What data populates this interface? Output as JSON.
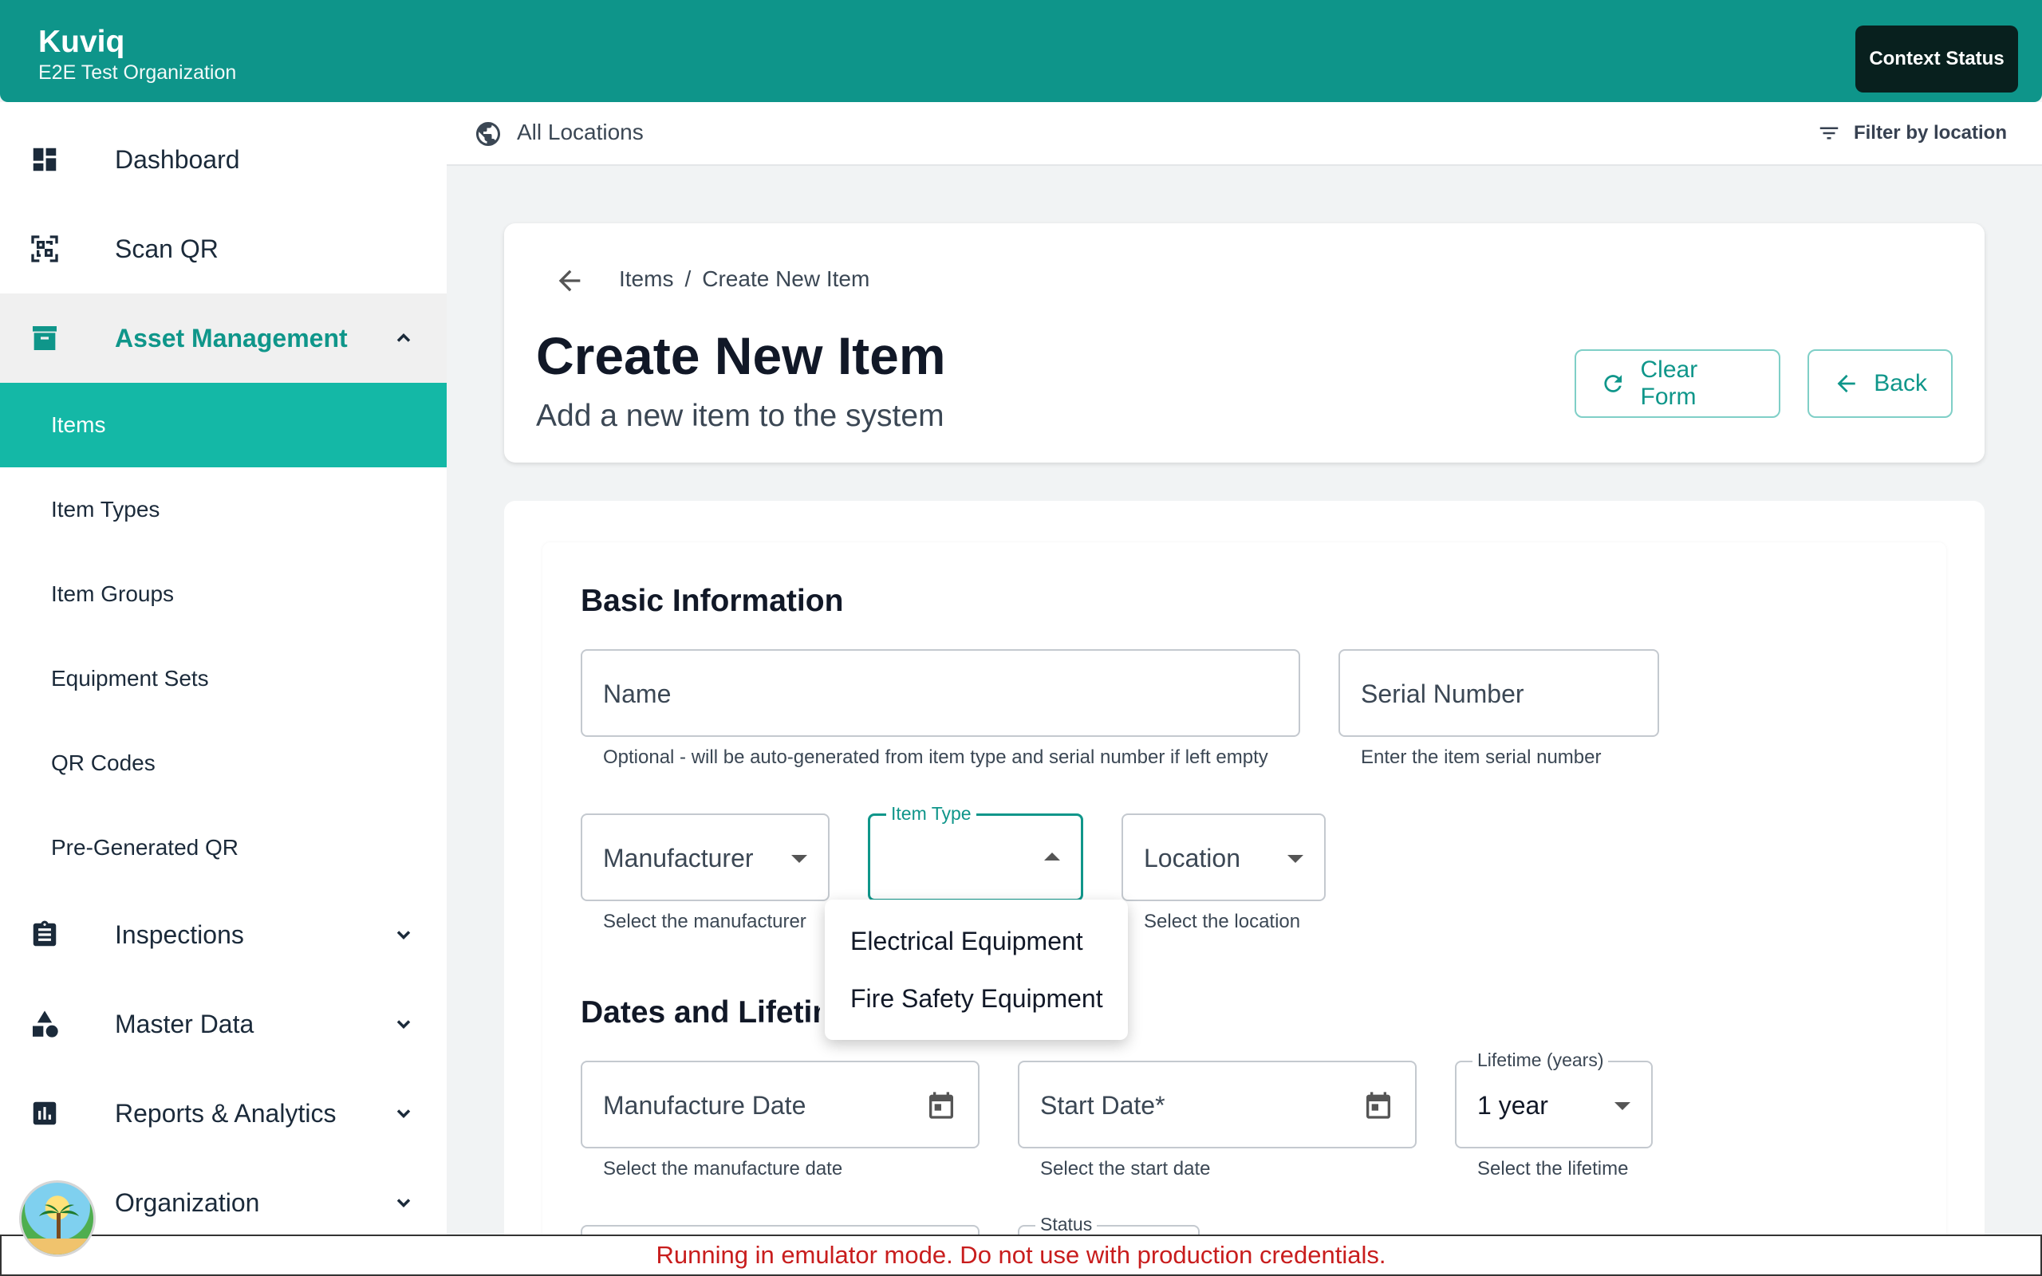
{
  "app": {
    "name": "Kuviq",
    "organization": "E2E Test Organization",
    "context_button": "Context Status"
  },
  "sidebar": {
    "items": [
      {
        "label": "Dashboard",
        "icon": "dashboard-icon"
      },
      {
        "label": "Scan QR",
        "icon": "qr-scan-icon"
      },
      {
        "label": "Asset Management",
        "icon": "archive-icon",
        "expanded": true
      },
      {
        "label": "Inspections",
        "icon": "clipboard-icon"
      },
      {
        "label": "Master Data",
        "icon": "shapes-icon"
      },
      {
        "label": "Reports & Analytics",
        "icon": "bar-chart-icon"
      },
      {
        "label": "Organization",
        "icon": "avatar"
      }
    ],
    "sub_items": [
      "Items",
      "Item Types",
      "Item Groups",
      "Equipment Sets",
      "QR Codes",
      "Pre-Generated QR"
    ],
    "selected_sub_item": "Items"
  },
  "location_bar": {
    "label": "All Locations",
    "filter_label": "Filter by location"
  },
  "header": {
    "breadcrumb_parent": "Items",
    "breadcrumb_separator": "/",
    "breadcrumb_current": "Create New Item",
    "title": "Create New Item",
    "subtitle": "Add a new item to the system",
    "clear_label": "Clear Form",
    "back_label": "Back"
  },
  "form": {
    "basic_title": "Basic Information",
    "name": {
      "placeholder": "Name",
      "helper": "Optional - will be auto-generated from item type and serial number if left empty"
    },
    "serial": {
      "placeholder": "Serial Number",
      "helper": "Enter the item serial number"
    },
    "manufacturer": {
      "placeholder": "Manufacturer",
      "helper": "Select the manufacturer"
    },
    "item_type": {
      "label": "Item Type",
      "value": ""
    },
    "location": {
      "placeholder": "Location",
      "helper": "Select the location"
    },
    "dates_title": "Dates and Lifetim",
    "manufacture_date": {
      "placeholder": "Manufacture Date",
      "helper": "Select the manufacture date"
    },
    "start_date": {
      "placeholder": "Start Date*",
      "helper": "Select the start date"
    },
    "lifetime": {
      "label": "Lifetime (years)",
      "value": "1 year",
      "helper": "Select the lifetime"
    },
    "status": {
      "label": "Status"
    }
  },
  "item_type_menu": {
    "options": [
      "Electrical Equipment",
      "Fire Safety Equipment"
    ]
  },
  "banner": {
    "text": "Running in emulator mode. Do not use with production credentials."
  },
  "colors": {
    "primary": "#0e958a",
    "selected": "#14b8a6",
    "banner_text": "#c81d1d"
  }
}
